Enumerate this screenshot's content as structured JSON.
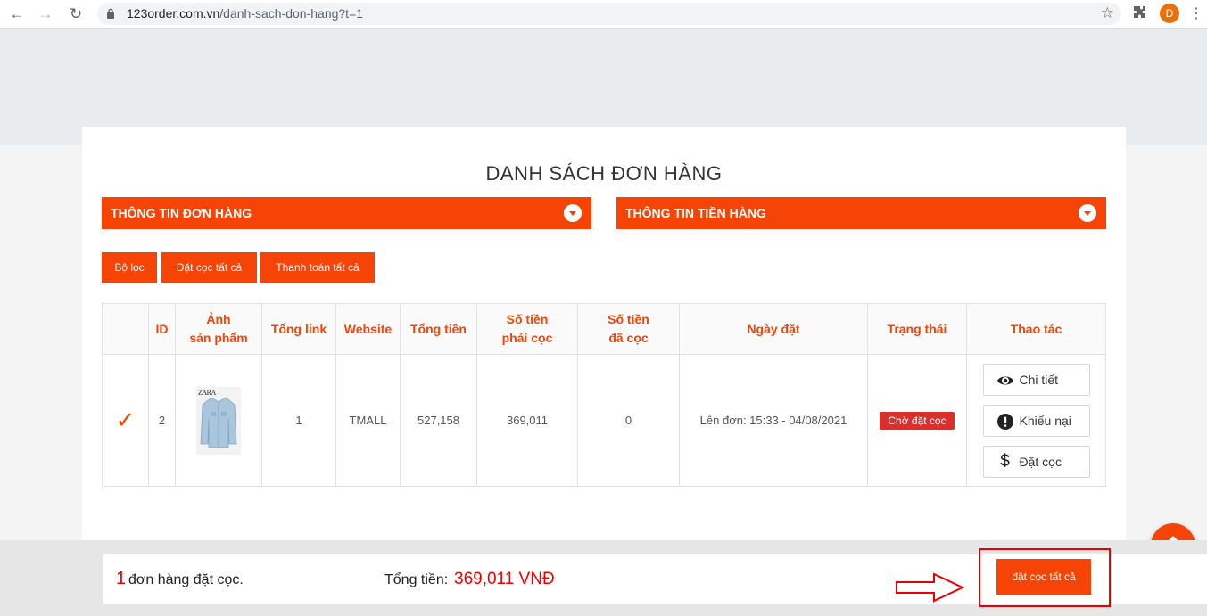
{
  "browser": {
    "url_host": "123order.com.vn",
    "url_path": "/danh-sach-don-hang?t=1",
    "profile_initial": "D"
  },
  "page": {
    "title": "DANH SÁCH ĐƠN HÀNG",
    "accordions": [
      {
        "label": "THÔNG TIN ĐƠN HÀNG"
      },
      {
        "label": "THÔNG TIN TIỀN HÀNG"
      }
    ],
    "toolbar": {
      "filter_label": "Bộ lọc",
      "deposit_all_label": "Đặt cọc tất cả",
      "pay_all_label": "Thanh toán tất cả"
    },
    "table": {
      "headers": {
        "id": "ID",
        "image_1": "Ảnh",
        "image_2": "sản phẩm",
        "total_link": "Tổng link",
        "website": "Website",
        "total_amount": "Tổng tiền",
        "deposit_due_1": "Số tiền",
        "deposit_due_2": "phải cọc",
        "deposited_1": "Số tiền",
        "deposited_2": "đã cọc",
        "order_date": "Ngày đặt",
        "status": "Trạng thái",
        "actions": "Thao tác"
      },
      "rows": [
        {
          "id": "2",
          "product_brand": "ZARA",
          "total_link": "1",
          "website": "TMALL",
          "total_amount": "527,158",
          "deposit_due": "369,011",
          "deposited": "0",
          "order_date": "Lên đơn: 15:33 - 04/08/2021",
          "status": "Chờ đặt cọc",
          "actions": {
            "detail": "Chi tiết",
            "complaint": "Khiếu nại",
            "deposit": "Đặt cọc"
          }
        }
      ]
    }
  },
  "bottom_bar": {
    "order_count": "1",
    "order_count_text": "đơn hàng đặt cọc.",
    "total_label": "Tổng tiền:",
    "total_value": "369,011 VNĐ",
    "deposit_all_label": "đặt cọc tất cả"
  },
  "colors": {
    "accent": "#f64306",
    "status_badge": "#d9302c",
    "highlight": "#ee0000"
  }
}
